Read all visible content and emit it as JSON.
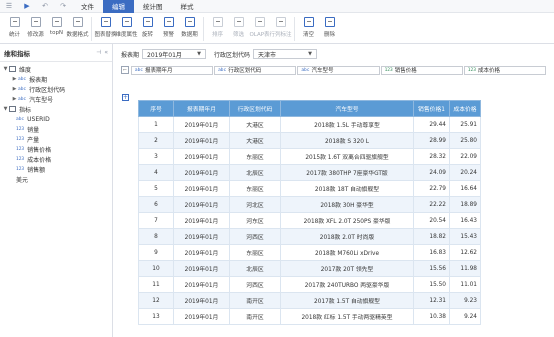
{
  "menubar": {
    "items": [
      "文件",
      "编辑",
      "统计图",
      "样式"
    ],
    "active_index": 1
  },
  "toolbar": {
    "buttons": [
      {
        "label": "统计",
        "disabled": false
      },
      {
        "label": "修改源",
        "disabled": false
      },
      {
        "label": "topN",
        "disabled": false
      },
      {
        "label": "数据格式",
        "disabled": false
      },
      {
        "label": "图表替换",
        "disabled": false
      },
      {
        "label": "维度属性",
        "disabled": false
      },
      {
        "label": "旋转",
        "disabled": false
      },
      {
        "label": "预警",
        "disabled": false
      },
      {
        "label": "数据期",
        "disabled": false
      },
      {
        "label": "排序",
        "disabled": true
      },
      {
        "label": "筛选",
        "disabled": true
      },
      {
        "label": "OLAP表",
        "disabled": true
      },
      {
        "label": "行列标注",
        "disabled": true
      },
      {
        "label": "清空",
        "disabled": false
      },
      {
        "label": "删除",
        "disabled": false
      }
    ]
  },
  "leftpanel": {
    "title": "维和指标",
    "tree": [
      {
        "label": "维度",
        "level": 1,
        "kind": "folder"
      },
      {
        "label": "报表期",
        "level": 2,
        "kind": "abc"
      },
      {
        "label": "行政区划代码",
        "level": 2,
        "kind": "abc"
      },
      {
        "label": "汽车型号",
        "level": 2,
        "kind": "abc"
      },
      {
        "label": "指标",
        "level": 1,
        "kind": "folder"
      },
      {
        "label": "USERID",
        "level": 3,
        "kind": "abc"
      },
      {
        "label": "销量",
        "level": 3,
        "kind": "num"
      },
      {
        "label": "产量",
        "level": 3,
        "kind": "num"
      },
      {
        "label": "销售价格",
        "level": 3,
        "kind": "num"
      },
      {
        "label": "成本价格",
        "level": 3,
        "kind": "num"
      },
      {
        "label": "销售额",
        "level": 3,
        "kind": "num"
      },
      {
        "label": "美元",
        "level": 3,
        "kind": "plain"
      }
    ]
  },
  "filters": {
    "period_label": "报表期",
    "period_value": "2019年01月",
    "region_label": "行政区划代码",
    "region_value": "天津市"
  },
  "fieldrow": {
    "chips": [
      {
        "tag": "abc",
        "label": "报表期年月"
      },
      {
        "tag": "abc",
        "label": "行政区划代码"
      },
      {
        "tag": "abc",
        "label": "汽车型号"
      },
      {
        "tag": "123",
        "label": "销售价格"
      },
      {
        "tag": "123",
        "label": "成本价格"
      }
    ]
  },
  "table": {
    "headers": [
      "序号",
      "报表期年月",
      "行政区划代码",
      "汽车型号",
      "销售价格1",
      "成本价格"
    ],
    "rows": [
      [
        "1",
        "2019年01月",
        "大港区",
        "2018款 1.5L 手动尊享型",
        "29.44",
        "25.91"
      ],
      [
        "2",
        "2019年01月",
        "大港区",
        "2018款 S 320 L",
        "28.99",
        "25.80"
      ],
      [
        "3",
        "2019年01月",
        "东丽区",
        "2015款 1.6T 双离合四驱旗舰型",
        "28.32",
        "22.09"
      ],
      [
        "4",
        "2019年01月",
        "北辰区",
        "2017款 380THP 7座豪华GT版",
        "24.09",
        "20.24"
      ],
      [
        "5",
        "2019年01月",
        "东丽区",
        "2018款 18T 自动旗舰型",
        "22.79",
        "16.64"
      ],
      [
        "6",
        "2019年01月",
        "河北区",
        "2018款 30H 豪华型",
        "22.22",
        "18.89"
      ],
      [
        "7",
        "2019年01月",
        "河东区",
        "2018款 XFL 2.0T 250PS 豪华版",
        "20.54",
        "16.43"
      ],
      [
        "8",
        "2019年01月",
        "河西区",
        "2018款 2.0T 时尚版",
        "18.82",
        "15.43"
      ],
      [
        "9",
        "2019年01月",
        "东丽区",
        "2018款 M760Li xDrive",
        "16.83",
        "12.62"
      ],
      [
        "10",
        "2019年01月",
        "北辰区",
        "2017款 20T 领先型",
        "15.56",
        "11.98"
      ],
      [
        "11",
        "2019年01月",
        "河西区",
        "2017款 240TURBO 两驱豪华版",
        "15.50",
        "11.01"
      ],
      [
        "12",
        "2019年01月",
        "南开区",
        "2017款 1.5T 自动旗舰型",
        "12.31",
        "9.23"
      ],
      [
        "13",
        "2019年01月",
        "南开区",
        "2018款 红标 1.5T 手动两驱精英型",
        "10.38",
        "9.24"
      ]
    ]
  }
}
